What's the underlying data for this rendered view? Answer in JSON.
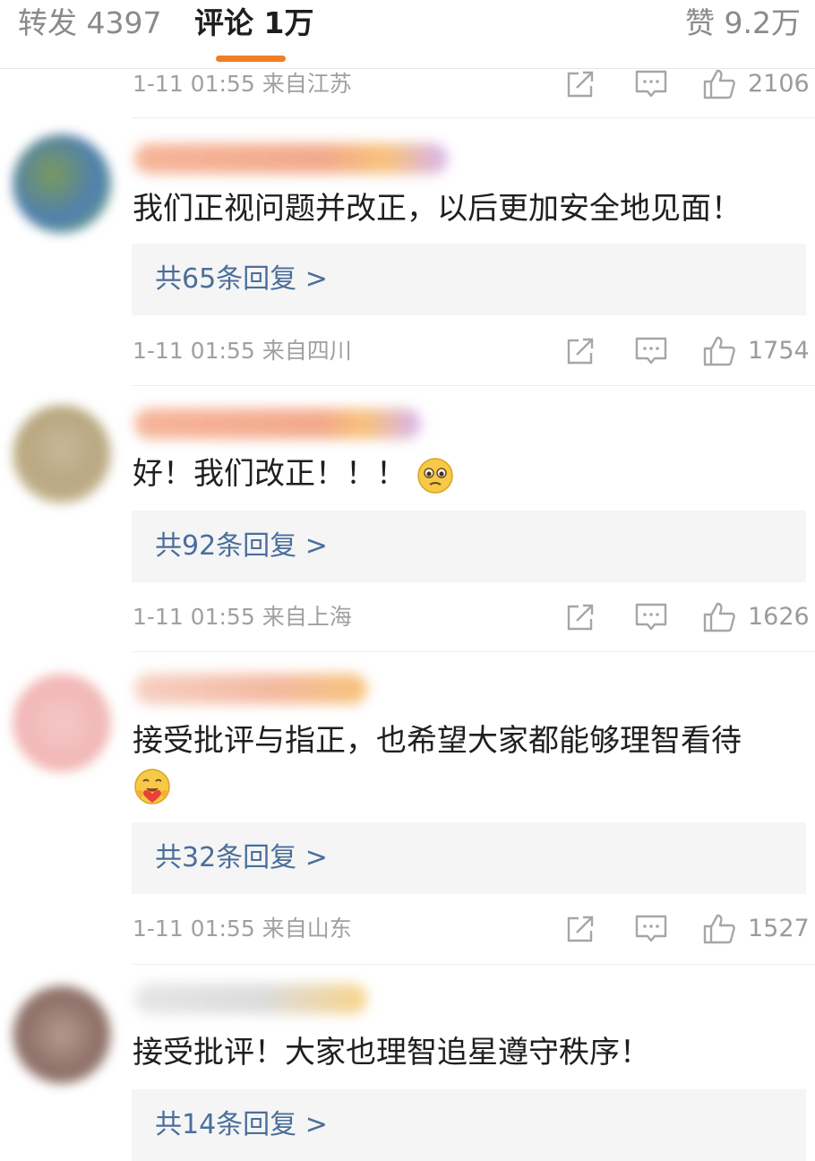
{
  "tabs": {
    "forward": "转发 4397",
    "comments": "评论 1万",
    "likes": "赞 9.2万"
  },
  "comments": [
    {
      "time": "1-11 01:55",
      "location": "来自江苏",
      "likes": "2106"
    },
    {
      "text": "我们正视问题并改正，以后更加安全地见面！",
      "replies": "共65条回复 >",
      "time": "1-11 01:55",
      "location": "来自四川",
      "likes": "1754"
    },
    {
      "text": "好！我们改正！！！",
      "emoji": "pleading-face-emoji",
      "replies": "共92条回复 >",
      "time": "1-11 01:55",
      "location": "来自上海",
      "likes": "1626"
    },
    {
      "text": "接受批评与指正，也希望大家都能够理智看待",
      "emoji": "hugging-heart-face-emoji",
      "replies": "共32条回复 >",
      "time": "1-11 01:55",
      "location": "来自山东",
      "likes": "1527"
    },
    {
      "text": "接受批评！大家也理智追星遵守秩序！",
      "replies": "共14条回复 >"
    }
  ],
  "colors": {
    "accent_underline": "#f07e22",
    "reply_link": "#4b6e9a",
    "meta_gray": "#a0a0a0",
    "reply_bg": "#f5f5f5"
  }
}
